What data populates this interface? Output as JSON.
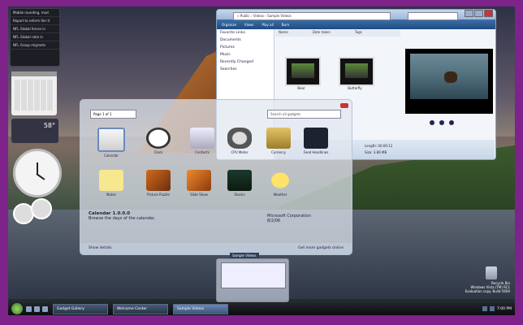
{
  "sidebar": {
    "feed_items": [
      "Mobile rounding, mod",
      "Report to reform Iter it",
      "NFL Global forces in",
      "NFL Global ratio in",
      "NFL Group migrants"
    ],
    "weather_temp": "58°"
  },
  "explorer": {
    "address": "« Public › Videos › Sample Videos",
    "toolbar": [
      "Organize",
      "Views",
      "Play all",
      "Burn"
    ],
    "nav": [
      "Favorite Links",
      "Documents",
      "Pictures",
      "Music",
      "Recently Changed",
      "Searches"
    ],
    "columns": [
      "Name",
      "Date taken",
      "Tags"
    ],
    "items": [
      "Bear",
      "Butterfly"
    ],
    "details": [
      "Length: 00:00:12",
      "Size: 3.86 MB"
    ]
  },
  "gallery": {
    "page": "Page 1 of 1",
    "search_placeholder": "Search all gadgets",
    "gadgets": [
      "Calendar",
      "Clock",
      "Contacts",
      "CPU Meter",
      "Currency",
      "Feed Headlines",
      "Notes",
      "Picture Puzzle",
      "Slide Show",
      "Stocks",
      "Weather"
    ],
    "selected_title": "Calendar 1.0.0.0",
    "selected_desc": "Browse the days of the calendar.",
    "publisher": "Microsoft Corporation",
    "publisher_date": "8/2/06",
    "show_details": "Show details",
    "get_more": "Get more gadgets online"
  },
  "thumb_title": "Sample Videos",
  "recycle": {
    "label": "Recycle Bin",
    "watermark": "Windows Vista (TM) RC1",
    "build": "Evaluation copy. Build 5600"
  },
  "taskbar": {
    "tasks": [
      "Gadget Gallery",
      "Welcome Center",
      "Sample Videos"
    ],
    "clock": "7:00 PM"
  }
}
